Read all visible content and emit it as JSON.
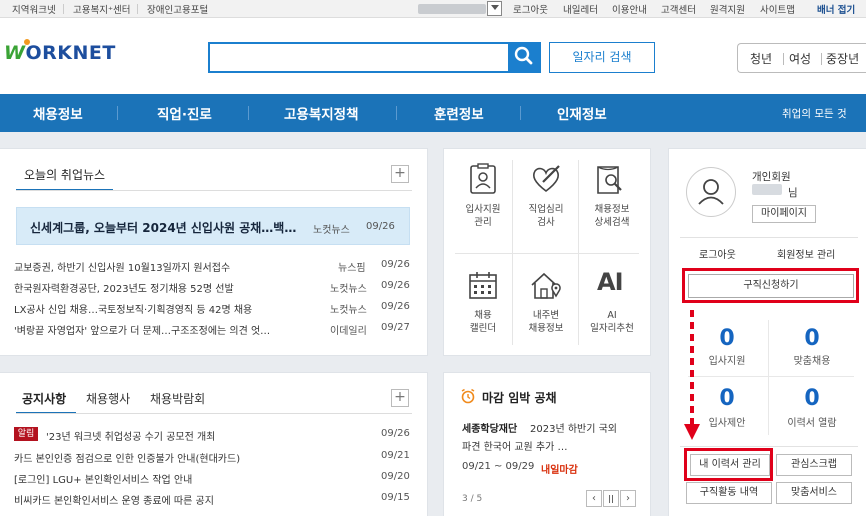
{
  "topbar": {
    "left_links": [
      "지역워크넷",
      "고용복지⁺센터",
      "장애인고용포털"
    ],
    "right_links": [
      "로그아웃",
      "내일레터",
      "이용안내",
      "고객센터",
      "원격지원",
      "사이트맵",
      "배너 접기"
    ]
  },
  "header": {
    "logo_text": "ORKNET",
    "job_search_button": "일자리 검색",
    "segments": [
      "청년",
      "여성",
      "중장년"
    ]
  },
  "nav": {
    "items": [
      "채용정보",
      "직업·진로",
      "고용복지정책",
      "훈련정보",
      "인재정보"
    ],
    "all_services": "취업의 모든 것"
  },
  "news": {
    "title": "오늘의 취업뉴스",
    "headline": {
      "text": "신세계그룹, 오늘부터 2024년 신입사원 공채…백…",
      "source": "노컷뉴스",
      "date": "09/26"
    },
    "rows": [
      {
        "text": "교보증권, 하반기 신입사원 10월13일까지 원서접수",
        "source": "뉴스핌",
        "date": "09/26"
      },
      {
        "text": "한국원자력환경공단, 2023년도 정기채용 52명 선발",
        "source": "노컷뉴스",
        "date": "09/26"
      },
      {
        "text": "LX공사 신입 채용…국토정보직·기획경영직 등 42명 채용",
        "source": "노컷뉴스",
        "date": "09/26"
      },
      {
        "text": "'벼랑끝 자영업자' 앞으로가 더 문제…구조조정에는 의견 엇…",
        "source": "이데일리",
        "date": "09/27"
      }
    ]
  },
  "notice": {
    "tabs": [
      "공지사항",
      "채용행사",
      "채용박람회"
    ],
    "badge": "알림",
    "rows": [
      {
        "text": "'23년 워크넷 취업성공 수기 공모전 개최",
        "date": "09/26"
      },
      {
        "text": "카드 본인인증 점검으로 인한 인증불가 안내(현대카드)",
        "date": "09/21"
      },
      {
        "text": "[로그인] LGU+ 본인확인서비스 작업 안내",
        "date": "09/20"
      },
      {
        "text": "비씨카드 본인확인서비스 운영 종료에 따른 공지",
        "date": "09/15"
      }
    ]
  },
  "services": [
    {
      "line1": "입사지원",
      "line2": "관리"
    },
    {
      "line1": "직업심리",
      "line2": "검사"
    },
    {
      "line1": "채용정보",
      "line2": "상세검색"
    },
    {
      "line1": "채용",
      "line2": "캘린더"
    },
    {
      "line1": "내주변",
      "line2": "채용정보"
    },
    {
      "line1": "AI",
      "line2": "일자리추천"
    }
  ],
  "deadline": {
    "title": "마감 임박 공채",
    "org": "세종학당재단",
    "text1": "2023년 하반기 국외",
    "text2": "파견 한국어 교원 추가 …",
    "period": "09/21 ~ 09/29",
    "due": "내일마감",
    "pager": "3 / 5",
    "pause_glyph": "||"
  },
  "member": {
    "type": "개인회원",
    "name_suffix": "님",
    "mypage": "마이페이지",
    "logout": "로그아웃",
    "manage": "회원정보 관리",
    "job_apply": "구직신청하기",
    "stats": [
      {
        "value": "0",
        "label": "입사지원"
      },
      {
        "value": "0",
        "label": "맞춤채용"
      },
      {
        "value": "0",
        "label": "입사제안"
      },
      {
        "value": "0",
        "label": "이력서 열람"
      }
    ],
    "links": [
      "내 이력서 관리",
      "관심스크랩",
      "구직활동 내역",
      "맞춤서비스"
    ]
  },
  "colors": {
    "brand_blue": "#1b73b8",
    "accent_red": "#e0001a",
    "stat_blue": "#1565c0"
  }
}
